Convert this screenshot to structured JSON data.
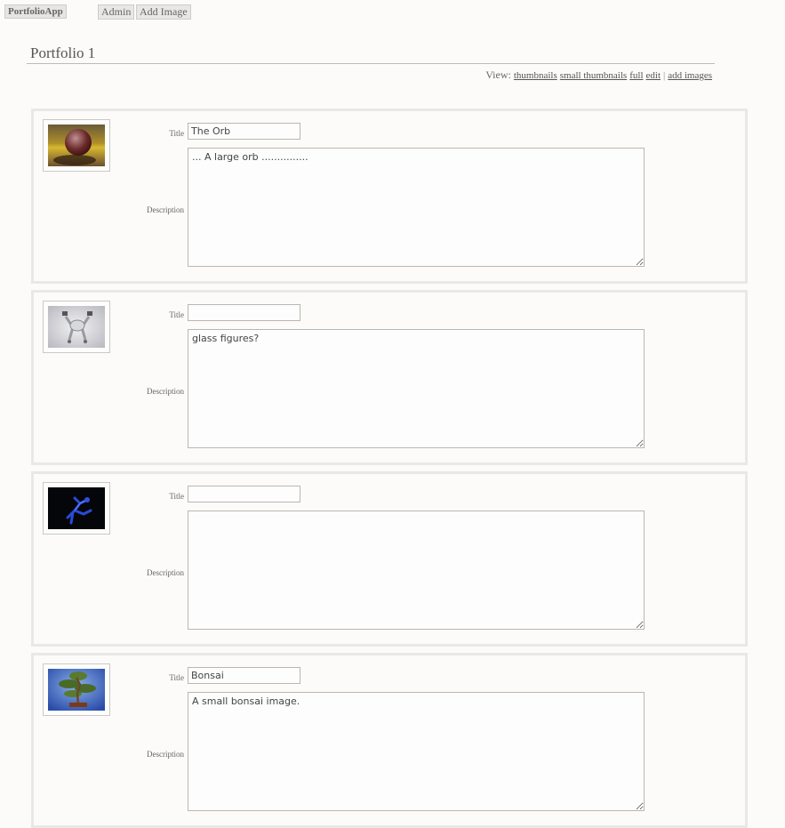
{
  "nav": {
    "brand": "PortfolioApp",
    "admin": "Admin",
    "add_image": "Add Image"
  },
  "page": {
    "title": "Portfolio 1"
  },
  "view_bar": {
    "label": "View:",
    "links": {
      "thumbnails": "thumbnails",
      "small_thumbnails": "small thumbnails",
      "full": "full",
      "edit": "edit",
      "separator": "|",
      "add_images": "add images"
    }
  },
  "labels": {
    "title": "Title",
    "description": "Description"
  },
  "images": [
    {
      "thumbnail_icon": "orb-icon",
      "title": "The Orb",
      "description": "... A large orb ..............."
    },
    {
      "thumbnail_icon": "glass-figures-icon",
      "title": "",
      "description": "glass figures?"
    },
    {
      "thumbnail_icon": "blue-figure-icon",
      "title": "",
      "description": ""
    },
    {
      "thumbnail_icon": "bonsai-icon",
      "title": "Bonsai",
      "description": "A small bonsai image."
    }
  ]
}
